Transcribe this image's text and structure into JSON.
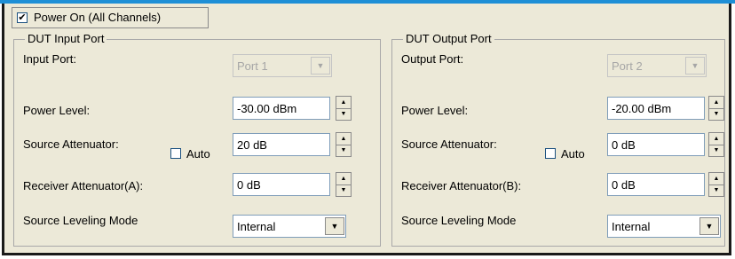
{
  "power": {
    "checked": true,
    "label": "Power On (All Channels)"
  },
  "icons": {
    "check": "✔",
    "dropdown": "▼",
    "spin_up": "▲",
    "spin_down": "▼"
  },
  "input_group": {
    "title": "DUT Input Port",
    "port_label": "Input Port:",
    "port_value": "Port 1",
    "power_label": "Power Level:",
    "power_value": "-30.00 dBm",
    "src_att_label": "Source Attenuator:",
    "auto_label": "Auto",
    "src_att_value": "20 dB",
    "rcv_att_label": "Receiver Attenuator(A):",
    "rcv_att_value": "0 dB",
    "leveling_label": "Source Leveling Mode",
    "leveling_value": "Internal"
  },
  "output_group": {
    "title": "DUT Output Port",
    "port_label": "Output Port:",
    "port_value": "Port 2",
    "power_label": "Power Level:",
    "power_value": "-20.00 dBm",
    "src_att_label": "Source Attenuator:",
    "auto_label": "Auto",
    "src_att_value": "0 dB",
    "rcv_att_label": "Receiver Attenuator(B):",
    "rcv_att_value": "0 dB",
    "leveling_label": "Source Leveling Mode",
    "leveling_value": "Internal"
  }
}
